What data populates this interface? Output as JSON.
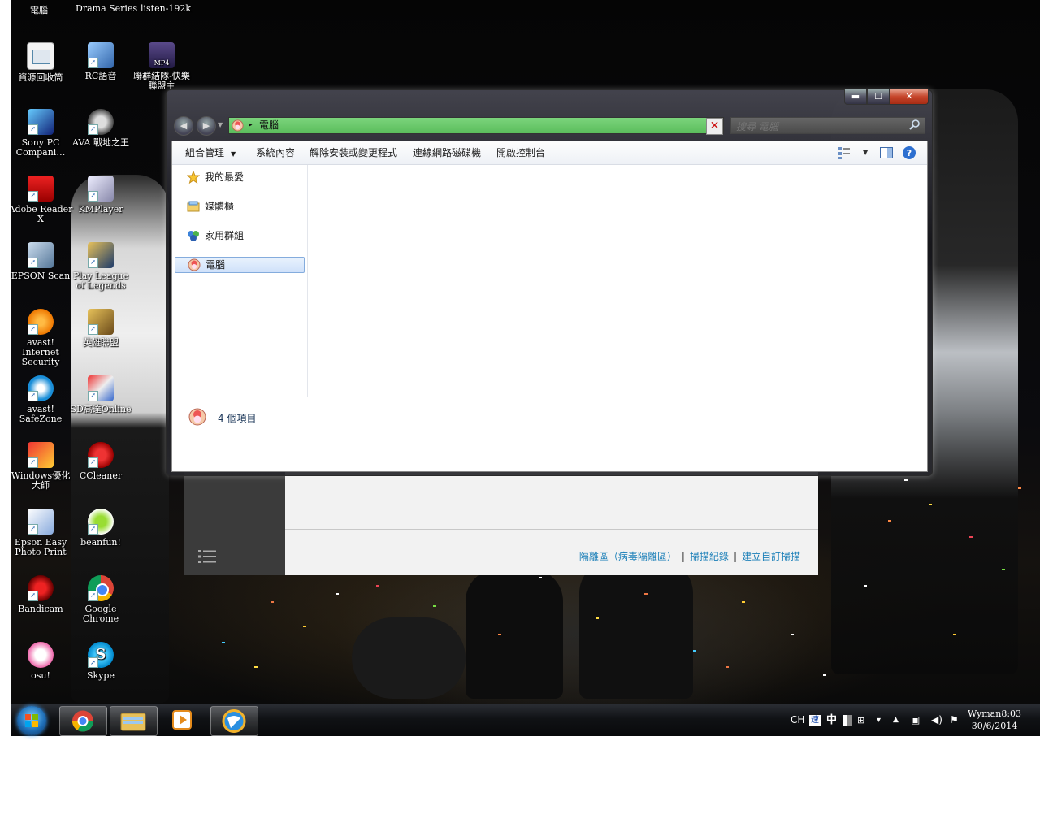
{
  "desktop": {
    "top_labels": [
      "電腦",
      "Drama Series",
      "listen-192k"
    ],
    "icons": [
      {
        "label": "資源回收筒",
        "icon": "recycle-bin-icon"
      },
      {
        "label": "RC語音",
        "icon": "rc-voice-icon"
      },
      {
        "label": "聯群結隊-快樂聯盟主",
        "icon": "mp4-file-icon"
      },
      {
        "label": "Sony PC Compani…",
        "icon": "sony-pc-companion-icon"
      },
      {
        "label": "AVA 戰地之王",
        "icon": "ava-game-icon"
      },
      {
        "label": "Adobe Reader X",
        "icon": "adobe-reader-icon"
      },
      {
        "label": "KMPlayer",
        "icon": "kmplayer-icon"
      },
      {
        "label": "EPSON Scan",
        "icon": "epson-scan-icon"
      },
      {
        "label": "Play League of Legends",
        "icon": "league-of-legends-icon"
      },
      {
        "label": "avast! Internet Security",
        "icon": "avast-icon"
      },
      {
        "label": "英雄聯盟",
        "icon": "league-tw-icon"
      },
      {
        "label": "avast! SafeZone",
        "icon": "avast-safezone-icon"
      },
      {
        "label": "SD高達Online",
        "icon": "sd-gundam-icon"
      },
      {
        "label": "Windows優化大師",
        "icon": "windows-optimizer-icon"
      },
      {
        "label": "CCleaner",
        "icon": "ccleaner-icon"
      },
      {
        "label": "Epson Easy Photo Print",
        "icon": "epson-photo-print-icon"
      },
      {
        "label": "beanfun!",
        "icon": "beanfun-icon"
      },
      {
        "label": "Bandicam",
        "icon": "bandicam-icon"
      },
      {
        "label": "Google Chrome",
        "icon": "chrome-icon"
      },
      {
        "label": "osu!",
        "icon": "osu-icon"
      },
      {
        "label": "Skype",
        "icon": "skype-icon"
      }
    ]
  },
  "background_app": {
    "links": [
      "隔離區（病毒隔離區）",
      "掃描紀錄",
      "建立自訂掃描"
    ],
    "separator": "|"
  },
  "explorer": {
    "title_buttons": {
      "minimize": "▬",
      "maximize": "☐",
      "close": "✕"
    },
    "address": {
      "path": "電腦",
      "separator": "▸",
      "dropdown": "▼"
    },
    "search": {
      "placeholder": "搜尋 電腦"
    },
    "toolbar": {
      "organize": "組合管理",
      "system_properties": "系統內容",
      "uninstall": "解除安裝或變更程式",
      "map_drive": "連線網路磁碟機",
      "control_panel": "開啟控制台"
    },
    "nav": [
      {
        "label": "我的最愛",
        "icon": "star-icon"
      },
      {
        "label": "媒體櫃",
        "icon": "library-icon"
      },
      {
        "label": "家用群組",
        "icon": "homegroup-icon"
      },
      {
        "label": "電腦",
        "icon": "computer-icon"
      }
    ],
    "details": {
      "count": "4 個項目"
    }
  },
  "taskbar": {
    "tray": {
      "lang": "CH",
      "ime": "中"
    },
    "clock": {
      "time": "Wyman8:03",
      "date": "30/6/2014"
    }
  }
}
